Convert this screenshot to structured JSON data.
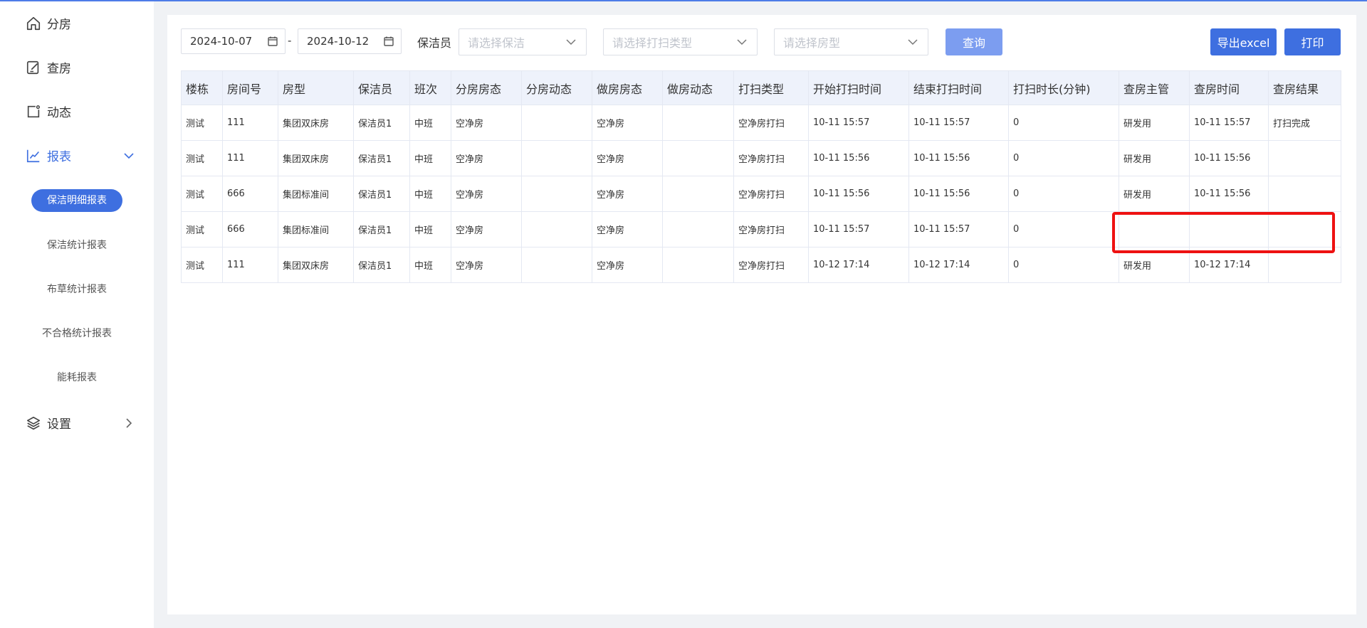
{
  "sidebar": {
    "items": [
      {
        "label": "分房",
        "icon": "home-icon"
      },
      {
        "label": "查房",
        "icon": "edit-icon"
      },
      {
        "label": "动态",
        "icon": "activity-icon"
      },
      {
        "label": "报表",
        "icon": "chart-icon"
      },
      {
        "label": "设置",
        "icon": "layers-icon"
      }
    ],
    "report_sub": [
      "保洁明细报表",
      "保洁统计报表",
      "布草统计报表",
      "不合格统计报表",
      "能耗报表"
    ],
    "accent": "#3e6fe0"
  },
  "filters": {
    "date_start": "2024-10-07",
    "date_sep": "-",
    "date_end": "2024-10-12",
    "cleaner_label": "保洁员",
    "cleaner_placeholder": "请选择保洁",
    "clean_type_placeholder": "请选择打扫类型",
    "room_type_placeholder": "请选择房型",
    "query_label": "查询",
    "export_label": "导出excel",
    "print_label": "打印"
  },
  "table": {
    "headers": [
      "楼栋",
      "房间号",
      "房型",
      "保洁员",
      "班次",
      "分房房态",
      "分房动态",
      "做房房态",
      "做房动态",
      "打扫类型",
      "开始打扫时间",
      "结束打扫时间",
      "打扫时长(分钟)",
      "查房主管",
      "查房时间",
      "查房结果"
    ],
    "rows": [
      [
        "测试",
        "111",
        "集团双床房",
        "保洁员1",
        "中班",
        "空净房",
        "",
        "空净房",
        "",
        "空净房打扫",
        "10-11 15:57",
        "10-11 15:57",
        "0",
        "研发用",
        "10-11 15:57",
        "打扫完成"
      ],
      [
        "测试",
        "111",
        "集团双床房",
        "保洁员1",
        "中班",
        "空净房",
        "",
        "空净房",
        "",
        "空净房打扫",
        "10-11 15:56",
        "10-11 15:56",
        "0",
        "研发用",
        "10-11 15:56",
        ""
      ],
      [
        "测试",
        "666",
        "集团标准间",
        "保洁员1",
        "中班",
        "空净房",
        "",
        "空净房",
        "",
        "空净房打扫",
        "10-11 15:56",
        "10-11 15:56",
        "0",
        "研发用",
        "10-11 15:56",
        ""
      ],
      [
        "测试",
        "666",
        "集团标准间",
        "保洁员1",
        "中班",
        "空净房",
        "",
        "空净房",
        "",
        "空净房打扫",
        "10-11 15:57",
        "10-11 15:57",
        "0",
        "",
        "",
        ""
      ],
      [
        "测试",
        "111",
        "集团双床房",
        "保洁员1",
        "中班",
        "空净房",
        "",
        "空净房",
        "",
        "空净房打扫",
        "10-12 17:14",
        "10-12 17:14",
        "0",
        "研发用",
        "10-12 17:14",
        ""
      ]
    ]
  },
  "highlight_color": "#ee1111"
}
